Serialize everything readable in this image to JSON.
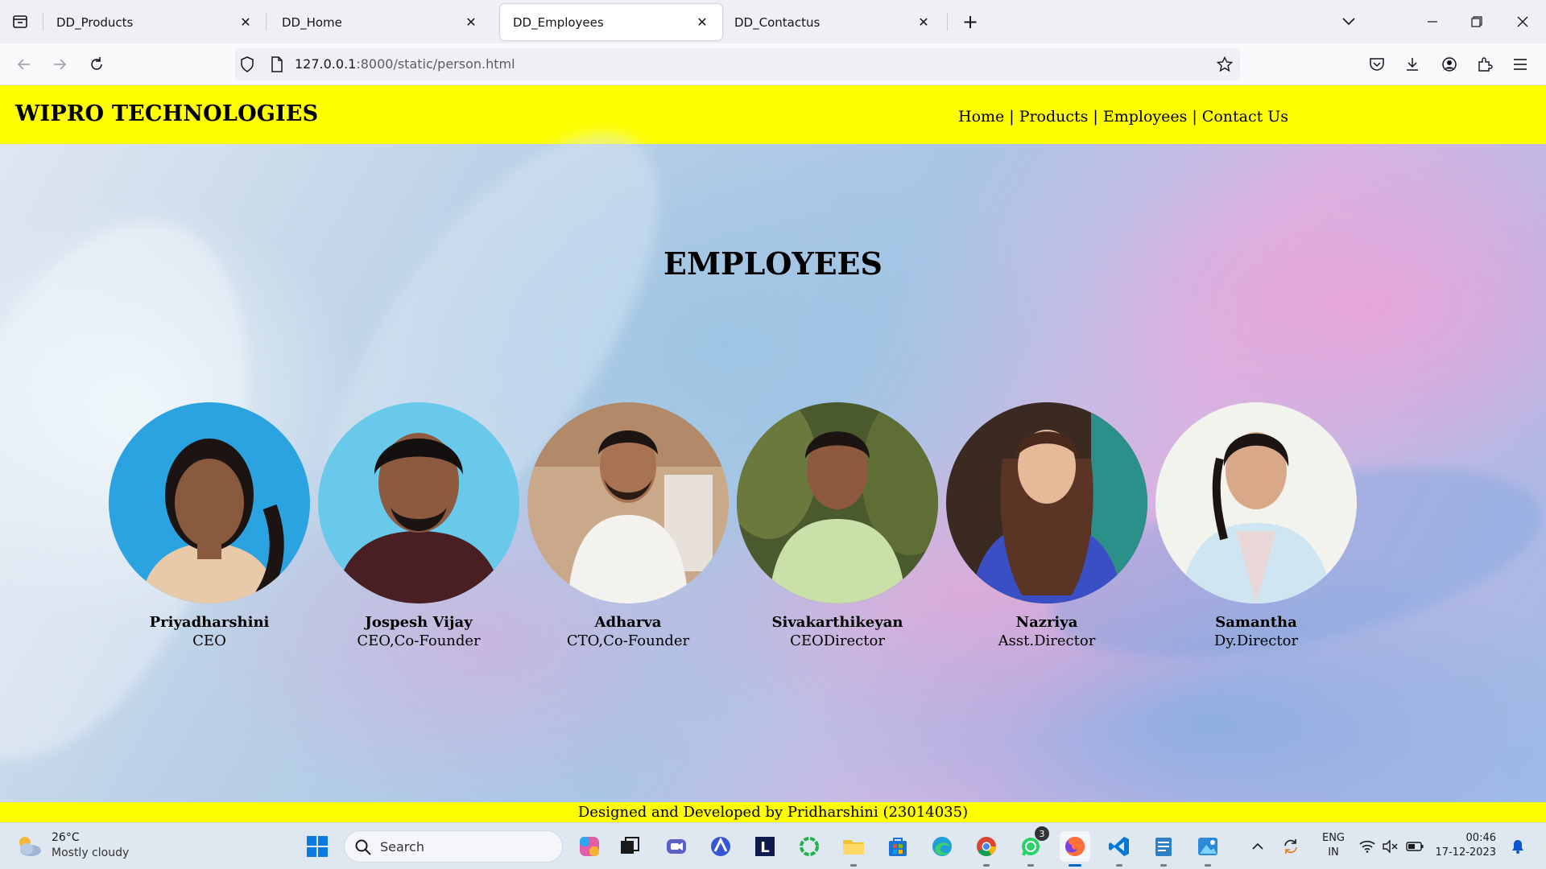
{
  "browser": {
    "tabs": [
      {
        "label": "DD_Products",
        "active": false
      },
      {
        "label": "DD_Home",
        "active": false
      },
      {
        "label": "DD_Employees",
        "active": true
      },
      {
        "label": "DD_Contactus",
        "active": false
      }
    ],
    "url_host": "127.0.0.1",
    "url_path": ":8000/static/person.html"
  },
  "site": {
    "brand": "WIPRO TECHNOLOGIES",
    "nav": [
      "Home",
      "Products",
      "Employees",
      "Contact Us"
    ],
    "nav_separator": "|",
    "title": "EMPLOYEES",
    "footer": "Designed and Developed by Pridharshini (23014035)",
    "header_color": "#ffff00"
  },
  "employees": [
    {
      "name": "Priyadharshini",
      "role": "CEO"
    },
    {
      "name": "Jospesh Vijay",
      "role": "CEO,Co-Founder"
    },
    {
      "name": "Adharva",
      "role": "CTO,Co-Founder"
    },
    {
      "name": "Sivakarthikeyan",
      "role": "CEODirector"
    },
    {
      "name": "Nazriya",
      "role": "Asst.Director"
    },
    {
      "name": "Samantha",
      "role": "Dy.Director"
    }
  ],
  "taskbar": {
    "weather_temp": "26°C",
    "weather_desc": "Mostly cloudy",
    "search_label": "Search",
    "whatsapp_badge": "3",
    "lang_line1": "ENG",
    "lang_line2": "IN",
    "time": "00:46",
    "date": "17-12-2023"
  }
}
